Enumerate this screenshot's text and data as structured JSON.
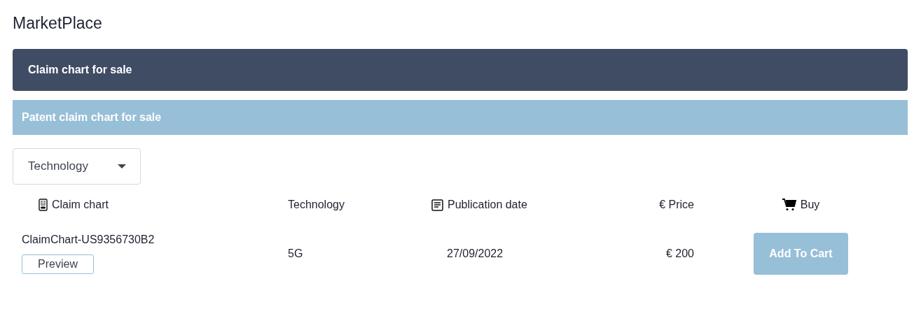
{
  "page_title": "MarketPlace",
  "section_header": "Claim chart for sale",
  "subheader": "Patent claim chart for sale",
  "filter": {
    "label": "Technology"
  },
  "table": {
    "columns": [
      {
        "label": "Claim chart"
      },
      {
        "label": "Technology"
      },
      {
        "label": "Publication date"
      },
      {
        "label": "€ Price"
      },
      {
        "label": "Buy"
      }
    ],
    "rows": [
      {
        "name": "ClaimChart-US9356730B2",
        "preview": "Preview",
        "technology": "5G",
        "date": "27/09/2022",
        "price": "€ 200",
        "action": "Add To Cart"
      }
    ]
  }
}
